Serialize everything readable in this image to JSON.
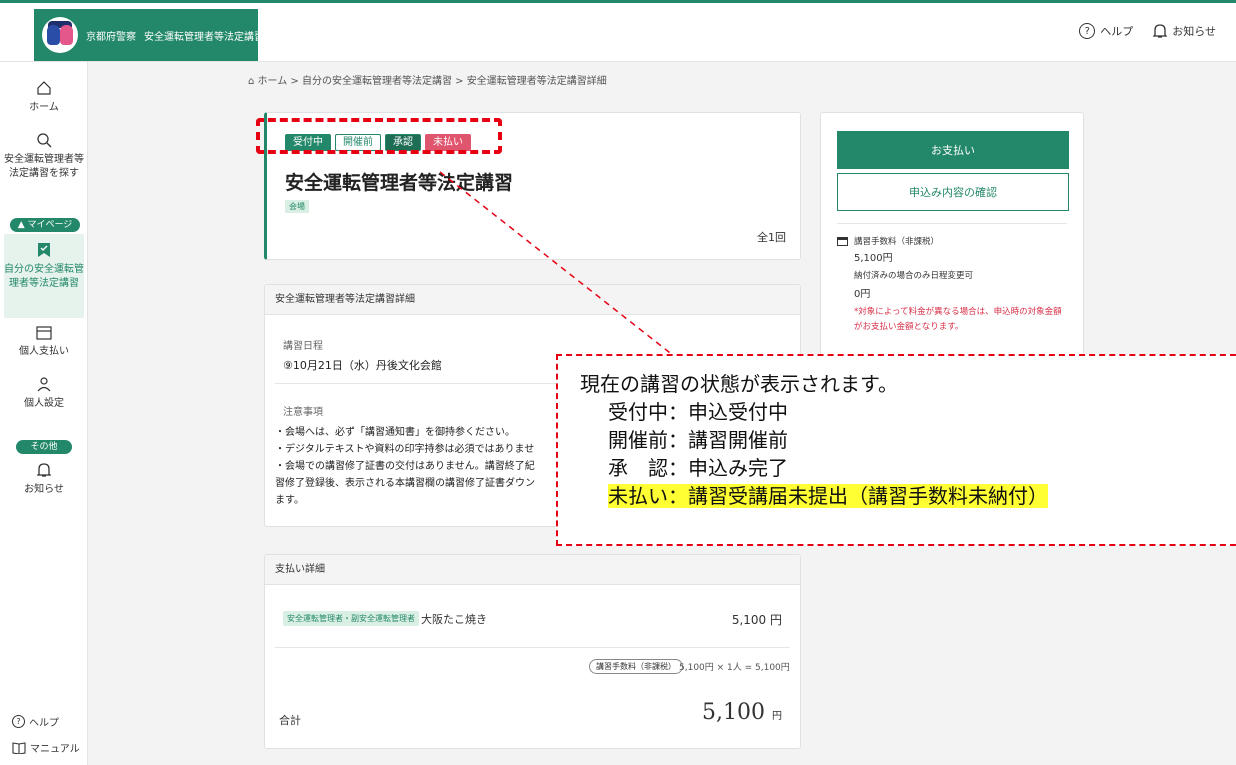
{
  "header": {
    "org": "京都府警察",
    "app_title": "安全運転管理者等法定講習",
    "help": "ヘルプ",
    "notice": "お知らせ"
  },
  "sidebar": {
    "home": "ホーム",
    "search": "安全運転管理者等法定講習を探す",
    "mypage_tag": "▲ マイページ",
    "my_courses": "自分の安全運転管理者等法定講習",
    "payments": "個人支払い",
    "settings": "個人設定",
    "other_tag": "その他",
    "notices": "お知らせ",
    "help": "ヘルプ",
    "manual": "マニュアル"
  },
  "breadcrumb": "ホーム > 自分の安全運転管理者等法定講習 > 安全運転管理者等法定講習詳細",
  "course": {
    "badges": [
      "受付中",
      "開催前",
      "承認",
      "未払い"
    ],
    "title": "安全運転管理者等法定講習",
    "venue_chip": "会場",
    "count": "全1回"
  },
  "detail": {
    "heading": "安全運転管理者等法定講習詳細",
    "date_label": "講習日程",
    "date_value": "⑨10月21日（水）丹後文化会館",
    "notes_label": "注意事項",
    "notes": [
      "・会場へは、必ず「講習通知書」を御持参ください。",
      "・デジタルテキストや資料の印字持参は必須ではありませ",
      "・会場での講習修了証書の交付はありません。講習終了紀",
      "習修了登録後、表示される本講習欄の講習修了証書ダウン",
      "ます。"
    ]
  },
  "payment": {
    "heading": "支払い詳細",
    "chip": "安全運転管理者・副安全運転管理者",
    "name": "大阪たこ焼き",
    "amount": "5,100 円",
    "fee_pill": "講習手数料（非課税）",
    "fee_calc": "5,100円 × 1人 = 5,100円",
    "total_label": "合計",
    "total_value": "5,100",
    "total_unit": "円"
  },
  "side": {
    "pay_button": "お支払い",
    "confirm_button": "申込み内容の確認",
    "fee_label": "講習手数料（非課税）",
    "fee_value": "5,100円",
    "change_label": "納付済みの場合のみ日程変更可",
    "change_value": "0円",
    "warning": "*対象によって料金が異なる場合は、申込時の対象金額がお支払い金額となります。"
  },
  "callout": {
    "intro": "現在の講習の状態が表示されます。",
    "line1": "受付中：申込受付中",
    "line2": "開催前：講習開催前",
    "line3": "承　認：申込み完了",
    "line4": "未払い：講習受講届未提出（講習手数料未納付）"
  },
  "colors": {
    "accent": "#23886a",
    "unpaid": "#e0556e",
    "annotation": "#e60012",
    "highlight": "#ffff33"
  }
}
